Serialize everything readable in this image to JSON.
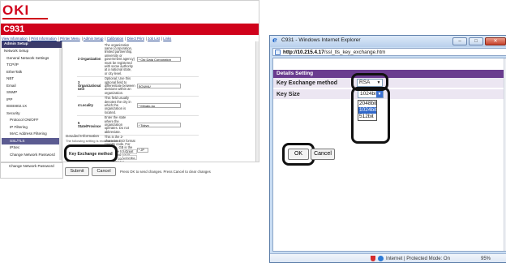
{
  "left_page": {
    "logo": "OKI",
    "model": "C931",
    "top_nav": [
      "View Information",
      "Print Information",
      "Printer Menu",
      "Admin Setup",
      "Calibration",
      "Direct Print",
      "Job List",
      "Links"
    ],
    "sidebar": {
      "header": "Admin Setup",
      "items": [
        "Network Setup",
        "General Network Settings",
        "TCP/IP",
        "EtherTalk",
        "NBT",
        "Email",
        "SNMP",
        "IPP",
        "IEEE802.1X",
        "Security",
        "Protocol ON/OFF",
        "IP Filtering",
        "MAC Address Filtering",
        "SSL/TLS",
        "IPSec",
        "Change Network Password"
      ],
      "selected_index": 13
    },
    "org_rows": [
      {
        "num": "2 Organization",
        "desc": "The organization name (corporation, limited partnership, university or government agency) must be registered with some authority at a national state, or city level.",
        "value": "* Oki Data Corporation"
      },
      {
        "num": "3 Organizational Unit",
        "desc": "Optional; Use this optional field to differentiate between divisions within an organization.",
        "value": "SOUMU"
      },
      {
        "num": "4 Locality",
        "desc": "This field usually denotes the city in which the organization is located.",
        "value": "* Minato-ku"
      },
      {
        "num": "5 State/Province",
        "desc": "Enter the state where the organization operates. Do not abbreviate.",
        "value": "* Tokyo"
      },
      {
        "num": "6 Country/Region",
        "desc": "This is the 2-character ISO format country code. For example, GB is the valid code for Great Britain, and US is the valid code for the United States.",
        "value": "* JP"
      }
    ],
    "detail_label": "Detailed Information",
    "detail_note": "The following setting is recommended.",
    "key_exchange_label": "Key Exchange method",
    "rsa_value": "RSA",
    "bit_value": "1024bit",
    "submit_label": "Submit",
    "cancel_label": "Cancel",
    "bottom_note": "Press OK to send changes. Press Cancel to clear changes"
  },
  "ie_window": {
    "title": "C931 - Windows Internet Explorer",
    "url_host": "http://10.215.4.17",
    "url_path": "/ssl_tls_key_exchange.htm",
    "section_title": "Details Setting",
    "key_exchange_label": "Key Exchange method",
    "key_exchange_value": "RSA",
    "key_size_label": "Key Size",
    "key_size_value": "1024bit",
    "key_size_options": [
      "2048bit",
      "1024bit",
      "512bit"
    ],
    "key_size_selected_index": 1,
    "ok_label": "OK",
    "cancel_label": "Cancel",
    "status_zone": "Internet | Protected Mode: On",
    "zoom": "95%"
  },
  "colors": {
    "brand_red": "#d0021b",
    "dialog_purple": "#6a3c8f",
    "selected_blue": "#3168c9"
  }
}
